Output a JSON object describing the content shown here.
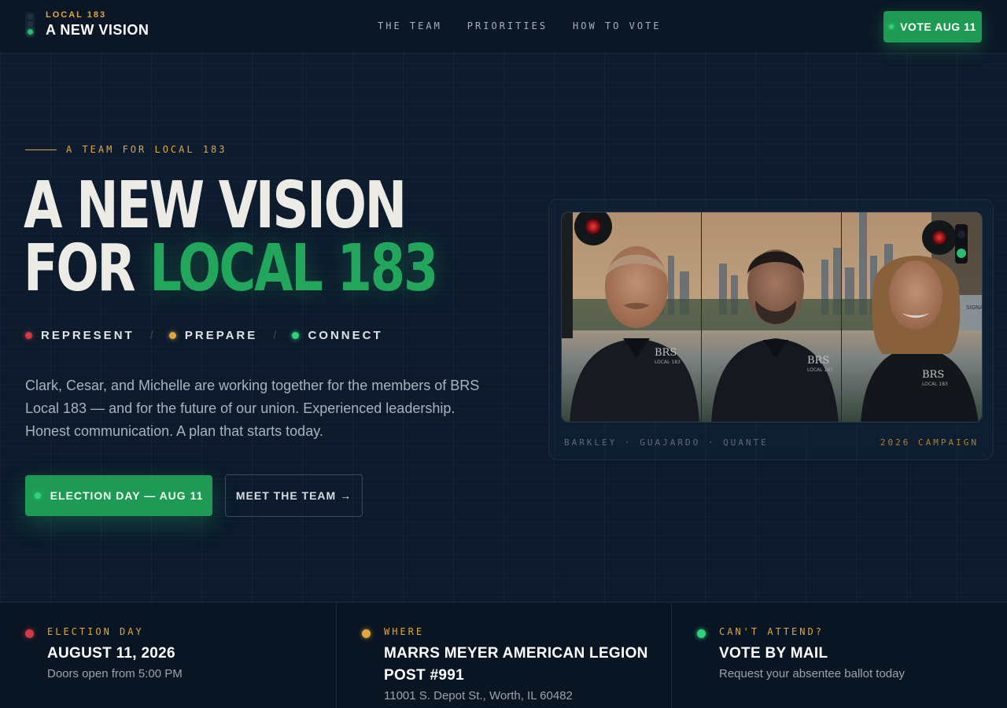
{
  "nav": {
    "brand_small": "LOCAL 183",
    "brand_big": "A NEW VISION",
    "links": [
      "THE TEAM",
      "PRIORITIES",
      "HOW TO VOTE"
    ],
    "cta": "VOTE AUG 11"
  },
  "hero": {
    "eyebrow": "A TEAM FOR LOCAL 183",
    "headline_line1": "A NEW VISION",
    "headline_line2_a": "FOR ",
    "headline_line2_b": "LOCAL 183",
    "pillars": [
      "REPRESENT",
      "PREPARE",
      "CONNECT"
    ],
    "separator": "/",
    "lede": "Clark, Cesar, and Michelle are working together for the members of BRS Local 183 — and for the future of our union. Experienced leadership. Honest communication. A plan that starts today.",
    "cta_primary": "ELECTION DAY — AUG 11",
    "cta_secondary": "MEET THE TEAM →"
  },
  "photo_card": {
    "caption_names": "BARKLEY · GUAJARDO · QUANTE",
    "caption_campaign": "2026 CAMPAIGN",
    "shirt_logo_1": "BRS",
    "shirt_logo_2": "LOCAL 183",
    "sign_text": "SIGNAL SYSTEMS"
  },
  "info": [
    {
      "label": "ELECTION DAY",
      "title": "AUGUST 11, 2026",
      "sub": "Doors open from 5:00 PM",
      "color": "#d13b45"
    },
    {
      "label": "WHERE",
      "title": "MARRS MEYER AMERICAN LEGION POST #991",
      "sub": "11001 S. Depot St., Worth, IL 60482",
      "color": "#e0a83b"
    },
    {
      "label": "CAN'T ATTEND?",
      "title": "VOTE BY MAIL",
      "sub": "Request your absentee ballot today",
      "color": "#2fd37a"
    }
  ],
  "colors": {
    "background": "#0c1a2b",
    "accent_green": "#22a65b",
    "accent_gold": "#e0a83b",
    "signal_red": "#d13b45"
  }
}
